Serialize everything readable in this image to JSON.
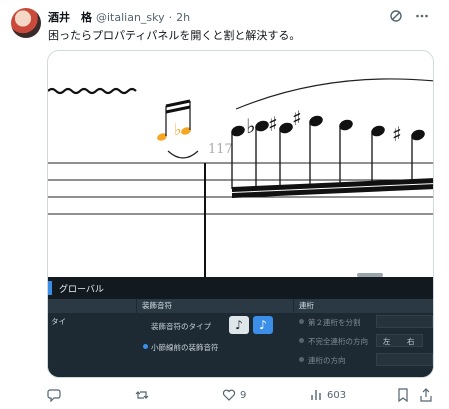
{
  "tweet": {
    "display_name": "酒井　格",
    "handle": "@italian_sky",
    "separator": "·",
    "time": "2h",
    "text": "困ったらプロパティパネルを開くと割と解決する。"
  },
  "score": {
    "tempo_fragment": "117"
  },
  "panel": {
    "tab_label": "グローバル",
    "col1": {
      "header": "",
      "item": "タイ"
    },
    "col2": {
      "header": "装飾音符",
      "type_label": "装飾音符のタイプ",
      "before_barline": "小節線前の装飾音符"
    },
    "col3": {
      "header": "連桁",
      "split_second": "第２連桁を分割",
      "incomplete_direction": "不完全連桁の方向",
      "left": "左",
      "right": "右",
      "beam_direction": "連桁の方向"
    }
  },
  "actions": {
    "likes": "9",
    "views": "603"
  },
  "colors": {
    "accent_blue": "#3b8fe8",
    "grace_orange": "#f5a623",
    "panel_bg": "#1e2a33"
  }
}
